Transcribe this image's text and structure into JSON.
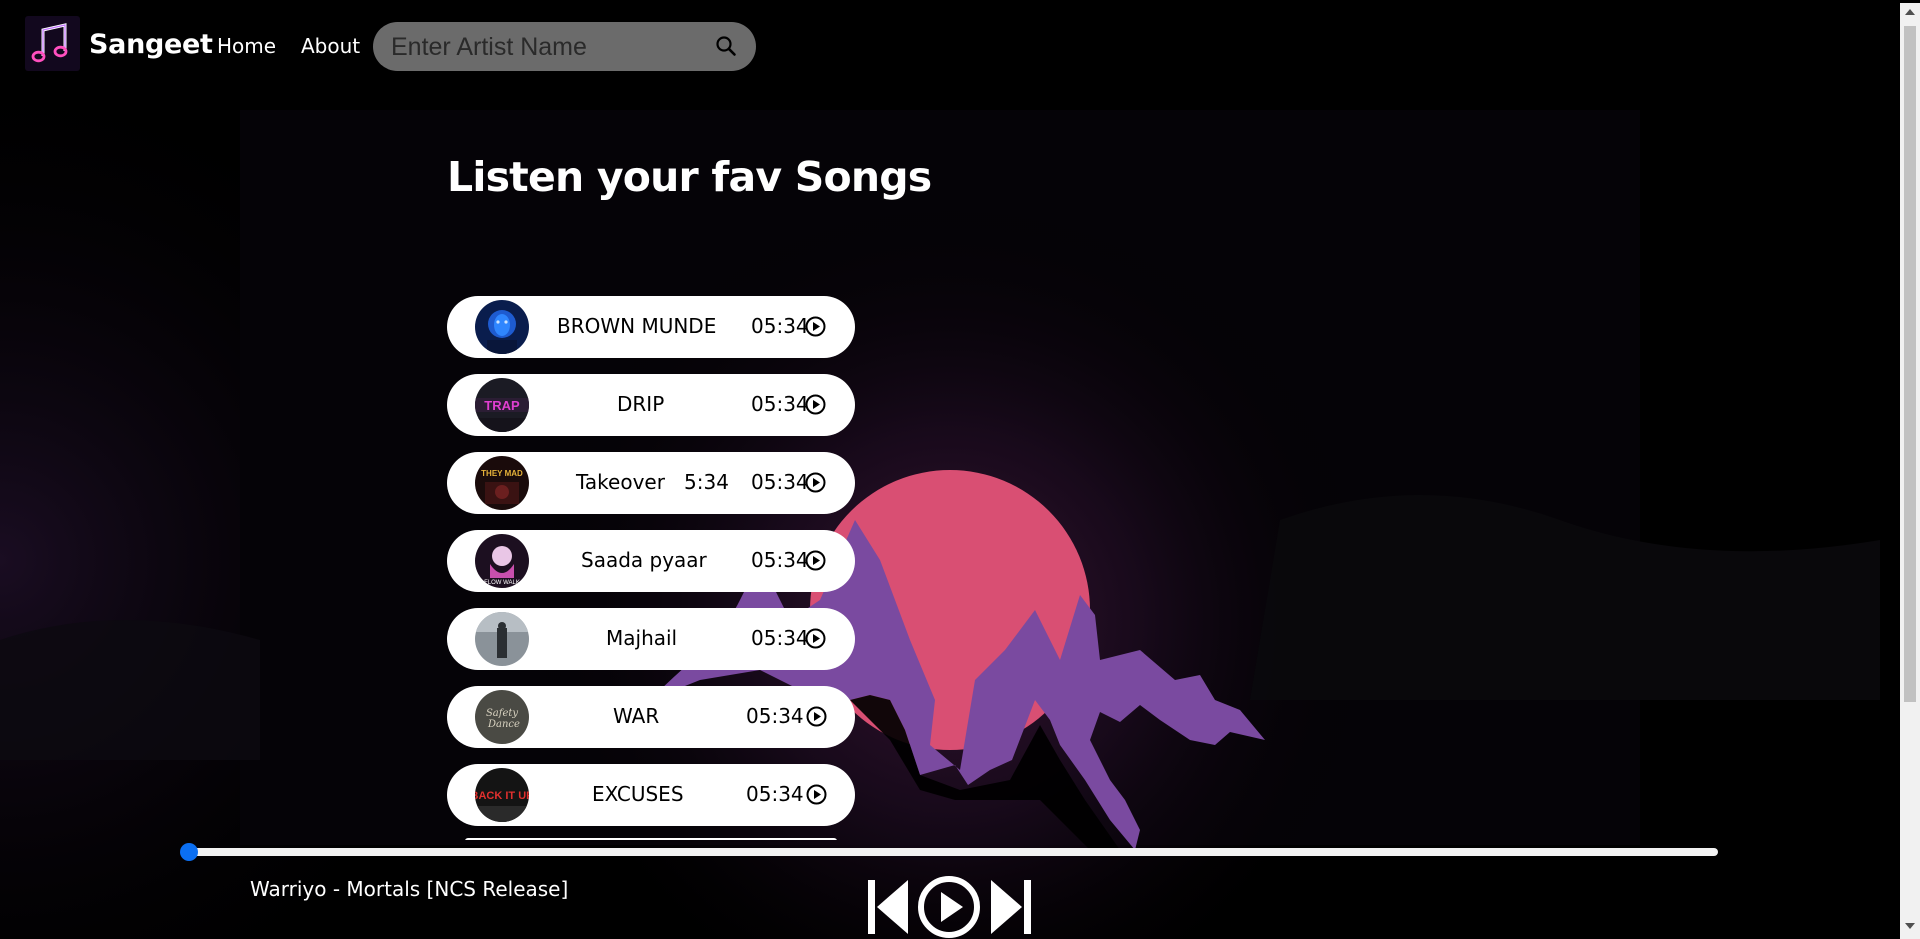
{
  "app": {
    "brand": "Sangeet",
    "nav": {
      "home": "Home",
      "about": "About"
    },
    "search": {
      "placeholder": "Enter Artist Name"
    }
  },
  "main": {
    "heading": "Listen your fav Songs",
    "songs": [
      {
        "name": "BROWN MUNDE",
        "duration": "05:34"
      },
      {
        "name": "DRIP",
        "duration": "05:34"
      },
      {
        "name": "Takeover   5:34",
        "duration": "05:34"
      },
      {
        "name": "Saada pyaar",
        "duration": "05:34"
      },
      {
        "name": "Majhail",
        "duration": "05:34"
      },
      {
        "name": "WAR",
        "duration": "05:34"
      },
      {
        "name": "EXCUSES",
        "duration": "05:34"
      }
    ]
  },
  "player": {
    "now_playing": "Warriyo - Mortals [NCS Release]",
    "progress": 0
  },
  "colors": {
    "background": "#000000",
    "sun": "#d94f73",
    "mountain": "#7a4aa0",
    "progress_thumb": "#0b6ff2"
  }
}
